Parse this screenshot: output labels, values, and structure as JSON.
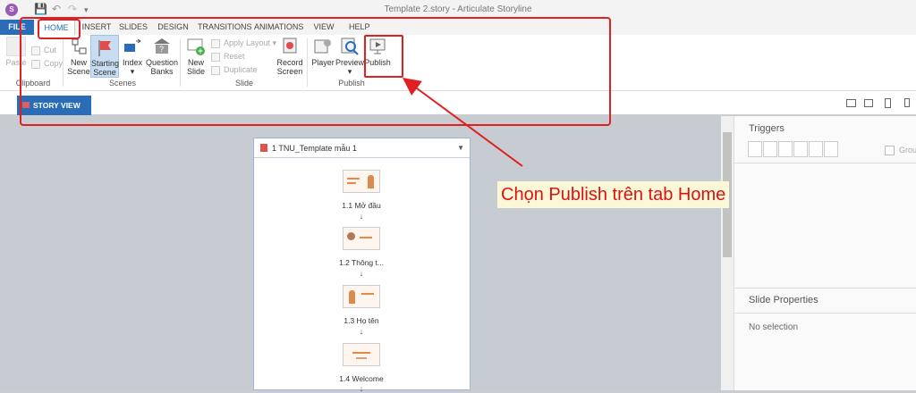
{
  "window": {
    "title": "Template 2.story - Articulate Storyline",
    "app_icon_letter": "S"
  },
  "tabs": [
    {
      "label": "FILE"
    },
    {
      "label": "HOME"
    },
    {
      "label": "INSERT"
    },
    {
      "label": "SLIDES"
    },
    {
      "label": "DESIGN"
    },
    {
      "label": "TRANSITIONS"
    },
    {
      "label": "ANIMATIONS"
    },
    {
      "label": "VIEW"
    },
    {
      "label": "HELP"
    }
  ],
  "ribbon": {
    "clipboard": {
      "paste": "Paste",
      "cut": "Cut",
      "copy": "Copy",
      "group": "Clipboard"
    },
    "scenes": {
      "new_scene_1": "New",
      "new_scene_2": "Scene",
      "starting_1": "Starting",
      "starting_2": "Scene",
      "index": "Index",
      "question_1": "Question",
      "question_2": "Banks",
      "group": "Scenes"
    },
    "slide": {
      "new_slide_1": "New",
      "new_slide_2": "Slide",
      "apply_layout": "Apply Layout",
      "reset": "Reset",
      "duplicate": "Duplicate",
      "record_1": "Record",
      "record_2": "Screen",
      "group": "Slide"
    },
    "publish": {
      "player": "Player",
      "preview": "Preview",
      "publish": "Publish",
      "group": "Publish"
    }
  },
  "story_view": {
    "label": "STORY VIEW"
  },
  "scene": {
    "title": "1 TNU_Template mẫu 1",
    "slides": [
      {
        "label": "1.1 Mở đầu"
      },
      {
        "label": "1.2 Thông t..."
      },
      {
        "label": "1.3 Họ tên"
      },
      {
        "label": "1.4 Welcome"
      }
    ]
  },
  "right_panel": {
    "triggers_title": "Triggers",
    "group_label": "Grou",
    "slide_properties_title": "Slide Properties",
    "no_selection": "No selection"
  },
  "annotation": {
    "text": "Chọn Publish trên tab Home",
    "color": "#e02020"
  },
  "colors": {
    "accent": "#2b6cb8",
    "highlight_box": "#e02020"
  }
}
